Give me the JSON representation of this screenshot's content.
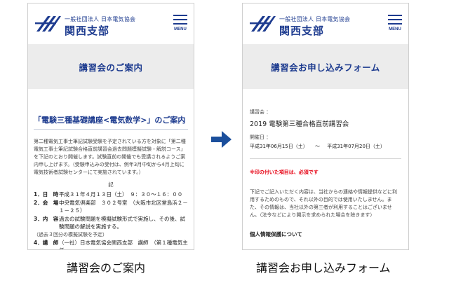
{
  "site": {
    "org_small": "一般社団法人 日本電気協会",
    "org_big": "関西支部",
    "menu_label": "MENU"
  },
  "left": {
    "banner_title": "講習会のご案内",
    "section_title": "「電験三種基礎講座<電気数学>」のご案内",
    "intro": "第二種電気工事士筆記試験受験を予定されている方を対象に「第二種電気工事士筆記試験合格直前講習会過去問題模擬試験・解説コース」を下記のとおり開催します。試験直前の開催でも受講されるようご案内申し上げます。（受験申込みの受付は、例年3月中旬から4月上旬に電気技術者試験センターにて実施されています。）",
    "record_mark": "記",
    "items": [
      {
        "key": "1．日　時",
        "value": "平成３１年４月１３日（土）　９：３０～１６：００"
      },
      {
        "key": "2．会　場",
        "value": "中央電気倶楽部　３０２号室　（大阪市北区堂島浜２－１－２５）"
      },
      {
        "key": "3．内　容",
        "value": "過去の試験問題を模擬試験形式で実施し、その後、試験問題の解説を実施する。"
      }
    ],
    "item3_sub": "（過去３回分の模擬試験を予定）",
    "item4": {
      "key": "4．講　師",
      "value": "（一社）日本電気協会関西支部　講師　（第１種電気主任"
    }
  },
  "right": {
    "banner_title": "講習会お申し込みフォーム",
    "label_course": "講習会 ：",
    "course_value": "2019 電験第三種合格直前講習会",
    "label_date": "開催日 ：",
    "date_from": "平成31年06月15日（土）",
    "date_sep": "～",
    "date_to": "平成31年07月20日（土）",
    "required_note": "※印の付いた項目は、必須です",
    "notice": "下記でご記入いただく内容は、当社からの連絡や情報提供などに利用するためのもので、それ以外の目的では使用いたしません。また、その情報は、当社以外の第三者が利用することはございません。（法令などにより開示を求められた場合を除きます）",
    "privacy_heading": "個人情報保護について"
  },
  "captions": {
    "left": "講習会のご案内",
    "right": "講習会お申し込みフォーム"
  },
  "colors": {
    "brand_blue": "#1d3b8f",
    "banner_gray": "#ececec",
    "arrow_blue": "#1b4f9c",
    "required_red": "#e60012"
  },
  "icons": {
    "logo": "jea-logo",
    "menu": "hamburger-icon",
    "arrow": "arrow-right-icon"
  }
}
